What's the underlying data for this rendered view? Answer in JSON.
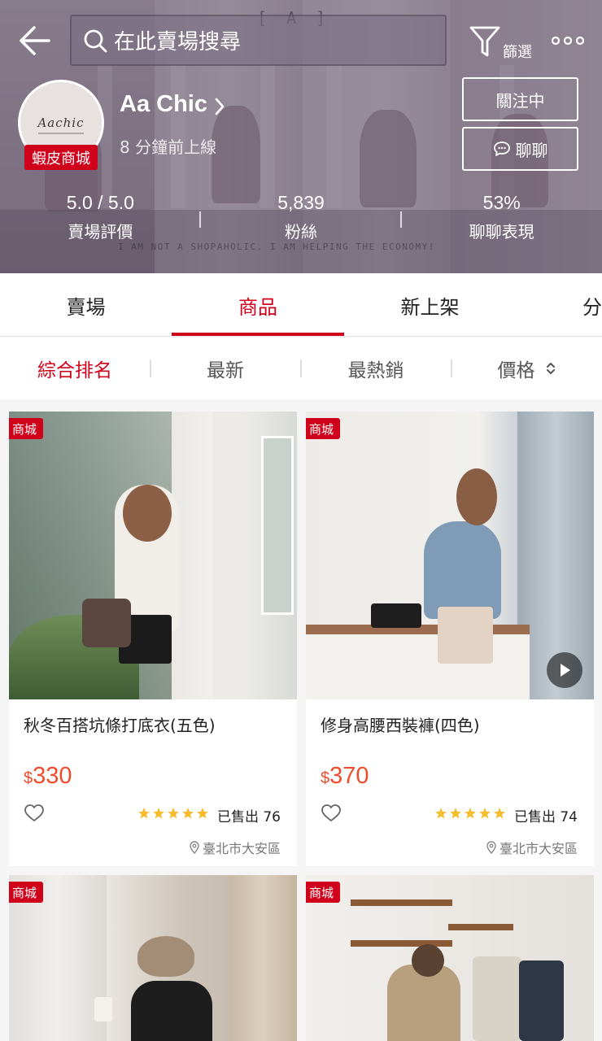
{
  "header": {
    "search_placeholder": "在此賣場搜尋",
    "filter_label": "篩選",
    "watermark_a": "[ A ]",
    "watermark_text": "I AM NOT A SHOPAHOLIC. I AM HELPING THE ECONOMY!"
  },
  "shop": {
    "logo_text": "Aachic",
    "badge": "蝦皮商城",
    "name": "Aa Chic",
    "online_status": "8 分鐘前上線",
    "follow_label": "關注中",
    "chat_label": "聊聊",
    "stats": [
      {
        "value": "5.0 / 5.0",
        "label": "賣場評價"
      },
      {
        "value": "5,839",
        "label": "粉絲"
      },
      {
        "value": "53%",
        "label": "聊聊表現"
      }
    ]
  },
  "tabs": [
    {
      "label": "賣場",
      "active": false
    },
    {
      "label": "商品",
      "active": true
    },
    {
      "label": "新上架",
      "active": false
    },
    {
      "label": "分",
      "active": false
    }
  ],
  "sort": [
    {
      "label": "綜合排名",
      "active": true
    },
    {
      "label": "最新",
      "active": false
    },
    {
      "label": "最熱銷",
      "active": false
    },
    {
      "label": "價格",
      "active": false
    }
  ],
  "products": [
    {
      "tag": "商城",
      "title": "秋冬百搭坑條打底衣(五色)",
      "currency": "$",
      "price": "330",
      "rating": 5,
      "sold": "已售出 76",
      "location": "臺北市大安區",
      "has_video": false
    },
    {
      "tag": "商城",
      "title": "修身高腰西裝褲(四色)",
      "currency": "$",
      "price": "370",
      "rating": 5,
      "sold": "已售出 74",
      "location": "臺北市大安區",
      "has_video": true
    },
    {
      "tag": "商城"
    },
    {
      "tag": "商城"
    }
  ],
  "colors": {
    "brand_red": "#d0011b",
    "price_orange": "#ee4d2d",
    "star_yellow": "#f6bc2c"
  }
}
